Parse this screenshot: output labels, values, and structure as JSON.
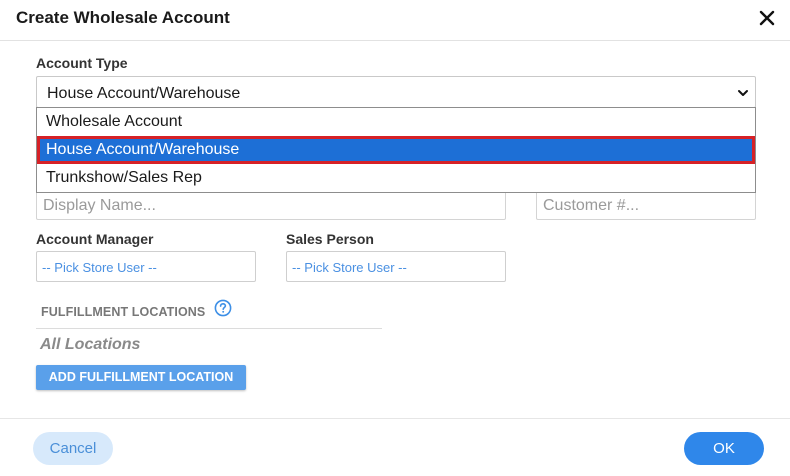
{
  "dialog": {
    "title": "Create Wholesale Account",
    "close_icon": "close-icon"
  },
  "account_type": {
    "label": "Account Type",
    "selected": "House Account/Warehouse",
    "options": [
      "Wholesale Account",
      "House Account/Warehouse",
      "Trunkshow/Sales Rep"
    ],
    "highlight_color": "#1d6fd6",
    "focus_outline_color": "#d62127"
  },
  "fields": {
    "display_name_placeholder": "Display Name...",
    "customer_number_placeholder": "Customer #..."
  },
  "account_manager": {
    "label": "Account Manager",
    "placeholder": "-- Pick Store User --"
  },
  "sales_person": {
    "label": "Sales Person",
    "placeholder": "-- Pick Store User --"
  },
  "fulfillment": {
    "title": "FULFILLMENT LOCATIONS",
    "help_icon": "help-circle-icon",
    "empty_text": "All Locations",
    "add_button": "ADD FULFILLMENT LOCATION"
  },
  "footer": {
    "cancel_label": "Cancel",
    "ok_label": "OK",
    "accent_color": "#2f87ea"
  }
}
